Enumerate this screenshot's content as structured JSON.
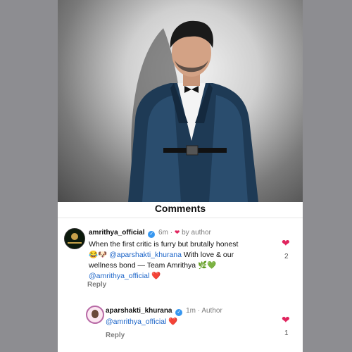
{
  "header": {
    "title": "Comments"
  },
  "photo": {
    "subject": "man-in-blue-tuxedo-photo"
  },
  "comments": [
    {
      "username": "amrithya_official",
      "time": "6m",
      "byline": "by author",
      "text_main": "When the first critic is furry but brutally honest",
      "emoji1": "😂🐶",
      "mention1": "@aparshakti_khurana",
      "text_mid": "With love & our wellness bond — Team Amrithya",
      "emoji2": "🌿💚",
      "mention2": "@amrithya_official",
      "emoji3": "❤️",
      "reply_label": "Reply",
      "likes": "2"
    },
    {
      "username": "aparshakti_khurana",
      "time": "1m",
      "byline": "Author",
      "mention": "@amrithya_official",
      "emoji": "❤️",
      "reply_label": "Reply",
      "likes": "1"
    }
  ],
  "colors": {
    "accent": "#3797f0",
    "heart": "#e0245e",
    "mention": "#1b64c8"
  }
}
